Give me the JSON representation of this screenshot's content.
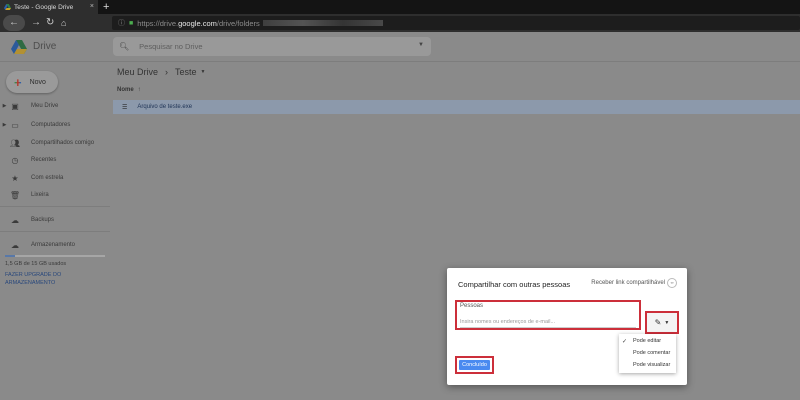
{
  "browser": {
    "tab_title": "Teste - Google Drive",
    "tab_close": "×",
    "new_tab": "+",
    "url_prefix": "https://drive.",
    "url_domain": "google.com",
    "url_path": "/drive/folders"
  },
  "header": {
    "app_name": "Drive",
    "search_placeholder": "Pesquisar no Drive"
  },
  "sidebar": {
    "new_label": "Novo",
    "items": [
      {
        "label": "Meu Drive",
        "icon": "drive-folder-icon",
        "expandable": true
      },
      {
        "label": "Computadores",
        "icon": "computer-icon",
        "expandable": true
      },
      {
        "label": "Compartilhados comigo",
        "icon": "people-icon",
        "expandable": false
      },
      {
        "label": "Recentes",
        "icon": "clock-icon",
        "expandable": false
      },
      {
        "label": "Com estrela",
        "icon": "star-icon",
        "expandable": false
      },
      {
        "label": "Lixeira",
        "icon": "trash-icon",
        "expandable": false
      }
    ],
    "backups_label": "Backups",
    "storage_label": "Armazenamento",
    "storage_used_text": "1,5 GB de 15 GB usados",
    "storage_fraction": 0.1,
    "upgrade_label": "FAZER UPGRADE DO ARMAZENAMENTO"
  },
  "main": {
    "breadcrumb_root": "Meu Drive",
    "breadcrumb_current": "Teste",
    "column_name": "Nome",
    "sort_arrow": "↑",
    "files": [
      {
        "name": "Arquivo de teste.exe"
      }
    ]
  },
  "share_dialog": {
    "title": "Compartilhar com outras pessoas",
    "link_text": "Receber link compartilhável",
    "people_label": "Pessoas",
    "people_placeholder": "Insira nomes ou endereços de e-mail...",
    "permission_options": [
      {
        "label": "Pode editar",
        "selected": true
      },
      {
        "label": "Pode comentar",
        "selected": false
      },
      {
        "label": "Pode visualizar",
        "selected": false
      }
    ],
    "done_label": "Concluído"
  },
  "colors": {
    "overlay": "#8a8a8a",
    "highlight_border": "#cc2f3a",
    "primary_button": "#4a8af0",
    "selected_row": "#8c99ab",
    "upgrade_link": "#29487c"
  }
}
